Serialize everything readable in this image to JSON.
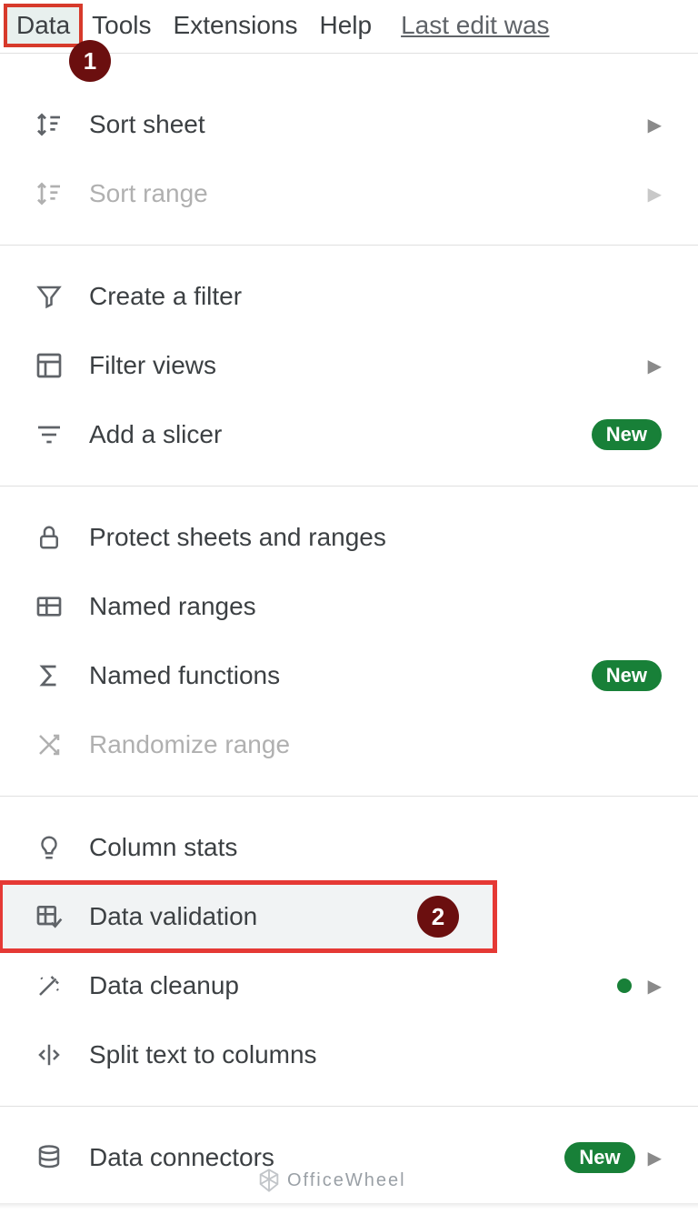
{
  "menubar": {
    "data": "Data",
    "tools": "Tools",
    "extensions": "Extensions",
    "help": "Help",
    "last_edit": "Last edit was"
  },
  "badge_new": "New",
  "menu": {
    "sort_sheet": "Sort sheet",
    "sort_range": "Sort range",
    "create_filter": "Create a filter",
    "filter_views": "Filter views",
    "add_slicer": "Add a slicer",
    "protect": "Protect sheets and ranges",
    "named_ranges": "Named ranges",
    "named_functions": "Named functions",
    "randomize": "Randomize range",
    "column_stats": "Column stats",
    "data_validation": "Data validation",
    "data_cleanup": "Data cleanup",
    "split_text": "Split text to columns",
    "data_connectors": "Data connectors"
  },
  "annotations": {
    "one": "1",
    "two": "2"
  },
  "watermark": "OfficeWheel"
}
